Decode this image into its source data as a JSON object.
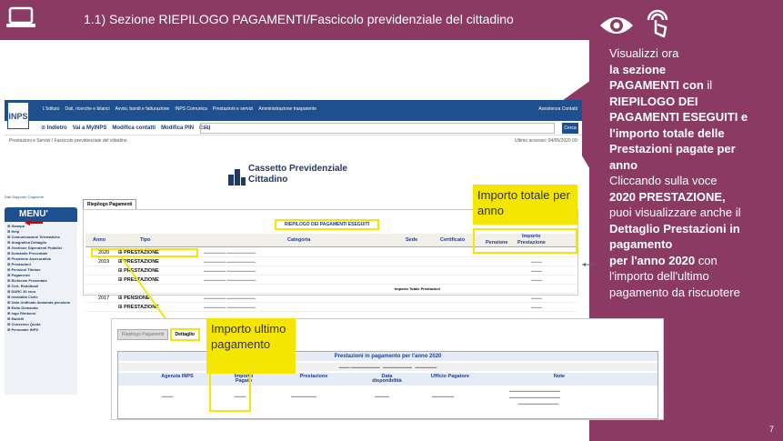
{
  "header": {
    "title": "1.1) Sezione RIEPILOGO PAGAMENTI/Fascicolo previdenziale del cittadino"
  },
  "panel": {
    "lines": [
      {
        "text": "Visualizzi ora",
        "bold": false
      },
      {
        "text": "la sezione",
        "bold": true
      },
      {
        "text": "PAGAMENTI con",
        "bold": true,
        "suffix": " il"
      },
      {
        "text": "RIEPILOGO DEI",
        "bold": true
      },
      {
        "text": "PAGAMENTI ESEGUITI e",
        "bold": true
      },
      {
        "text": "l'importo totale delle",
        "bold": true
      },
      {
        "text": "Prestazioni pagate per",
        "bold": true
      },
      {
        "text": "anno",
        "bold": true
      },
      {
        "text": "Cliccando sulla voce",
        "bold": false
      },
      {
        "text": "2020 PRESTAZIONE,",
        "bold": true
      },
      {
        "text": "puoi visualizzare anche il",
        "bold": false
      },
      {
        "text": "Dettaglio Prestazioni in",
        "bold": true
      },
      {
        "text": "pagamento",
        "bold": true
      },
      {
        "text": "per l'anno 2020",
        "bold": true,
        "suffix": " con"
      },
      {
        "text": "l'importo dell'ultimo",
        "bold": false
      },
      {
        "text": "pagamento da riscuotere",
        "bold": false
      }
    ],
    "page_number": "7"
  },
  "inps": {
    "logo": "INPS",
    "top_links": [
      "L'Istituto",
      "Dati, ricerche e bilanci",
      "Avvisi, bandi e fatturazione",
      "INPS Comunica",
      "Prestazioni e servizi",
      "Amministrazione trasparente"
    ],
    "top_right": "Assistenza  Contatti",
    "nav": [
      "Indietro",
      "Vai a MyINPS",
      "Modifica contatti",
      "Modifica PIN",
      "Esci"
    ],
    "search_button": "Cerca",
    "breadcrumb": "Prestazioni e Servizi  /  Fascicolo previdenziale del cittadino",
    "last_access": "Ultimo accesso: 04/05/2020 09:",
    "app_title_1": "Cassetto Previdenziale",
    "app_title_2": "Cittadino",
    "side_buttons": "Dati Supporto   Cognome",
    "menu_label": "MENU'",
    "side_items": [
      "Stampa",
      "Help",
      "Comunicazione Telematiche",
      "Anagrafica Dettaglio",
      "Gestione Dipendenti Pubblici",
      "Domande Presentate",
      "Posizione Assicurativa",
      "Prestazioni",
      "Pensioni Titolare",
      "Pagamenti",
      "Richieste Presentate",
      "Cert. Reddituali",
      "DURC 30 euro",
      "Invalidità Civile",
      "Dato Unificato domanda pensione",
      "Esito Domanda",
      "Ingo Rimborsi",
      "Modelli",
      "Consenso Quota",
      "Personale INPS"
    ],
    "tab_riepilogo": "Riepilogo Pagamenti",
    "riepilogo_title": "RIEPILOGO DEI PAGAMENTI ESEGUITI",
    "columns": {
      "anno": "Anno",
      "tipo": "Tipo",
      "categoria": "Categoria",
      "sede": "Sede",
      "certificato": "Certificato",
      "importo": "Importo",
      "pensione": "Pensione",
      "prestazione": "Prestazione"
    },
    "rows": [
      {
        "anno": "2020",
        "tipo": "PRESTAZIONE"
      },
      {
        "anno": "2019",
        "tipo": "PRESTAZIONE"
      },
      {
        "anno": "",
        "tipo": "PRESTAZIONE"
      },
      {
        "anno": "",
        "tipo": "PRESTAZIONE"
      },
      {
        "anno": "",
        "tipo": "",
        "total": "Importo Totale Prestazioni"
      },
      {
        "anno": "2017",
        "tipo": "PENSIONE"
      },
      {
        "anno": "",
        "tipo": "PRESTAZIONE"
      }
    ]
  },
  "dettaglio": {
    "tab_inactive": "Riepilogo Pagamenti",
    "tab_active": "Dettaglio",
    "title": "Prestazioni in pagamento per l'anno  2020",
    "columns": [
      "Agenzia INPS",
      "Importo Pagato",
      "Prestazione",
      "Data disponibilità",
      "Ufficio Pagatore",
      "Note"
    ]
  },
  "callouts": {
    "importo_totale": "Importo totale per anno",
    "importo_ultimo": "Importo ultimo pagamento"
  },
  "colors": {
    "brand": "#8a3a63",
    "highlight": "#f5e600",
    "inps_blue": "#1e4f8f"
  }
}
